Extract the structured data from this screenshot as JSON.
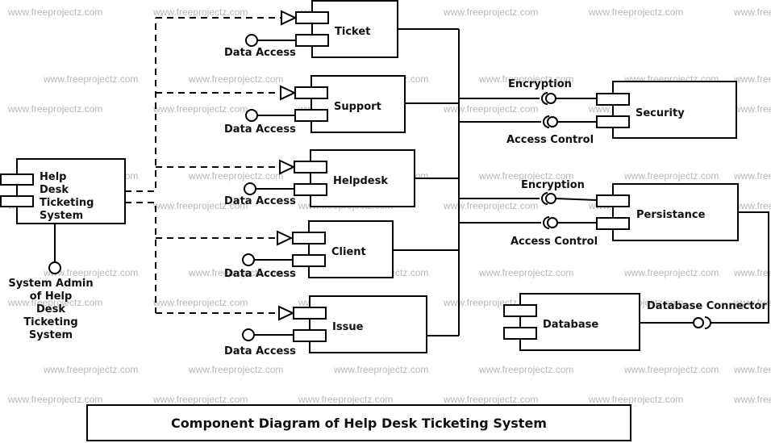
{
  "watermark": "www.freeprojectz.com",
  "title": "Component Diagram of Help Desk Ticketing System",
  "main_component": {
    "name_lines": [
      "Help",
      "Desk",
      "Ticketing",
      "System"
    ],
    "provided_interface_lines": [
      "System Admin",
      "of Help",
      "Desk",
      "Ticketing",
      "System"
    ]
  },
  "components": [
    {
      "id": "ticket",
      "name": "Ticket",
      "interface": "Data Access"
    },
    {
      "id": "support",
      "name": "Support",
      "interface": "Data Access"
    },
    {
      "id": "helpdesk",
      "name": "Helpdesk",
      "interface": "Data Access"
    },
    {
      "id": "client",
      "name": "Client",
      "interface": "Data Access"
    },
    {
      "id": "issue",
      "name": "Issue",
      "interface": "Data Access"
    }
  ],
  "security": {
    "name": "Security",
    "interfaces": [
      "Encryption",
      "Access Control"
    ]
  },
  "persistance": {
    "name": "Persistance",
    "interfaces": [
      "Encryption",
      "Access Control"
    ]
  },
  "database": {
    "name": "Database",
    "interface": "Database Connector"
  }
}
